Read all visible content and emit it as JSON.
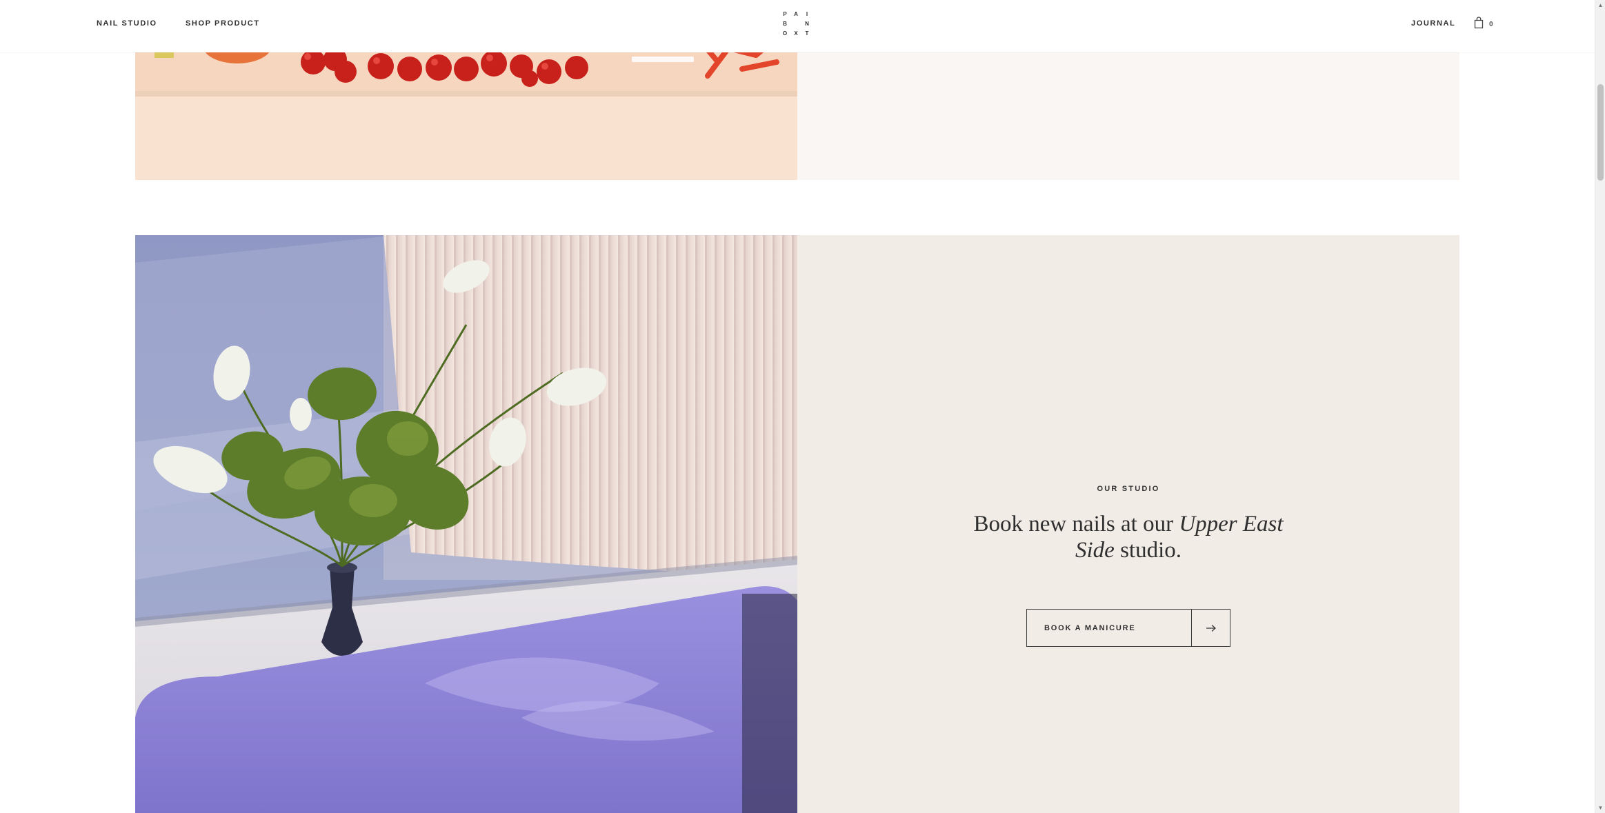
{
  "header": {
    "nav_left": [
      "NAIL STUDIO",
      "SHOP PRODUCT"
    ],
    "logo_letters": [
      "P",
      "A",
      "I",
      "B",
      "",
      "N",
      "O",
      "X",
      "T"
    ],
    "nav_right": [
      "JOURNAL"
    ],
    "bag_icon": "shopping-bag-icon",
    "bag_count": "0"
  },
  "studio": {
    "eyebrow": "OUR STUDIO",
    "headline_before": "Book new nails at our ",
    "headline_italic_1": "Upper East Side",
    "headline_after": " studio.",
    "cta_label": "BOOK A MANICURE",
    "cta_icon": "arrow-right-icon"
  },
  "colors": {
    "panel_bg": "#f2ece7",
    "top_panel_bg": "#f9f6f4",
    "text": "#2f2f2f"
  }
}
